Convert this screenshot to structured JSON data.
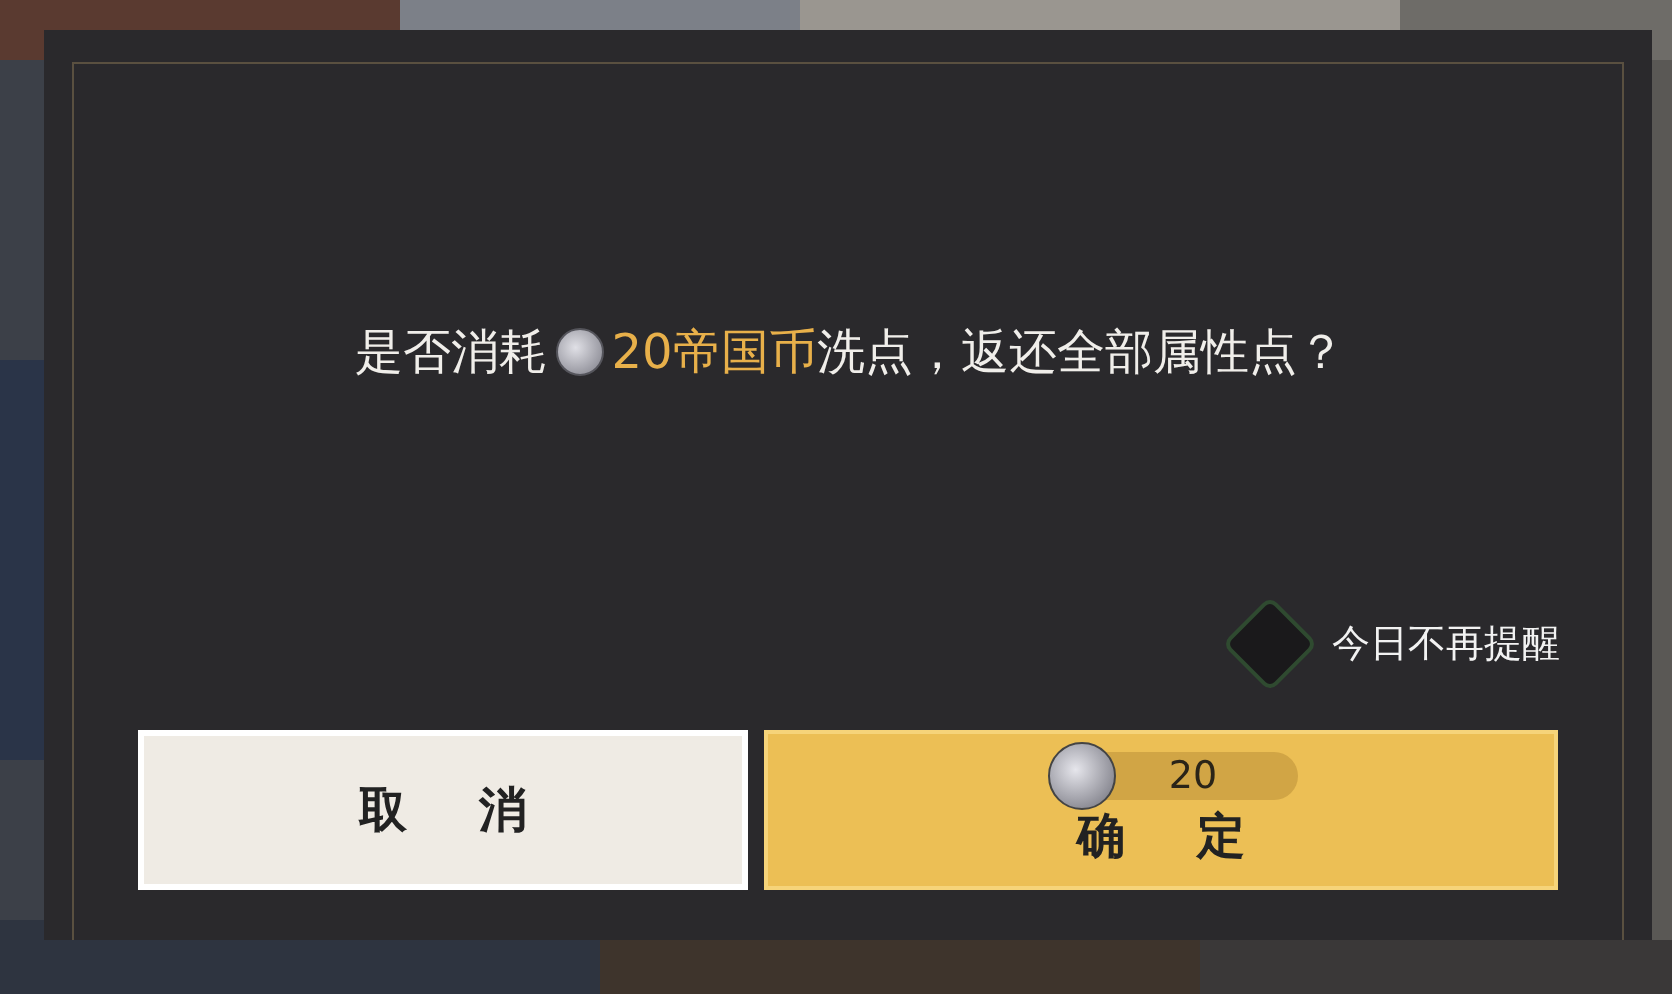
{
  "dialog": {
    "message": {
      "before": "是否消耗",
      "cost": "20帝国币",
      "after": "洗点，返还全部属性点？"
    },
    "dont_remind": {
      "label": "今日不再提醒",
      "checked": false
    },
    "buttons": [
      {
        "kind": "cancel",
        "label": "取消"
      },
      {
        "kind": "confirm",
        "label": "确定",
        "cost": "20"
      }
    ]
  }
}
